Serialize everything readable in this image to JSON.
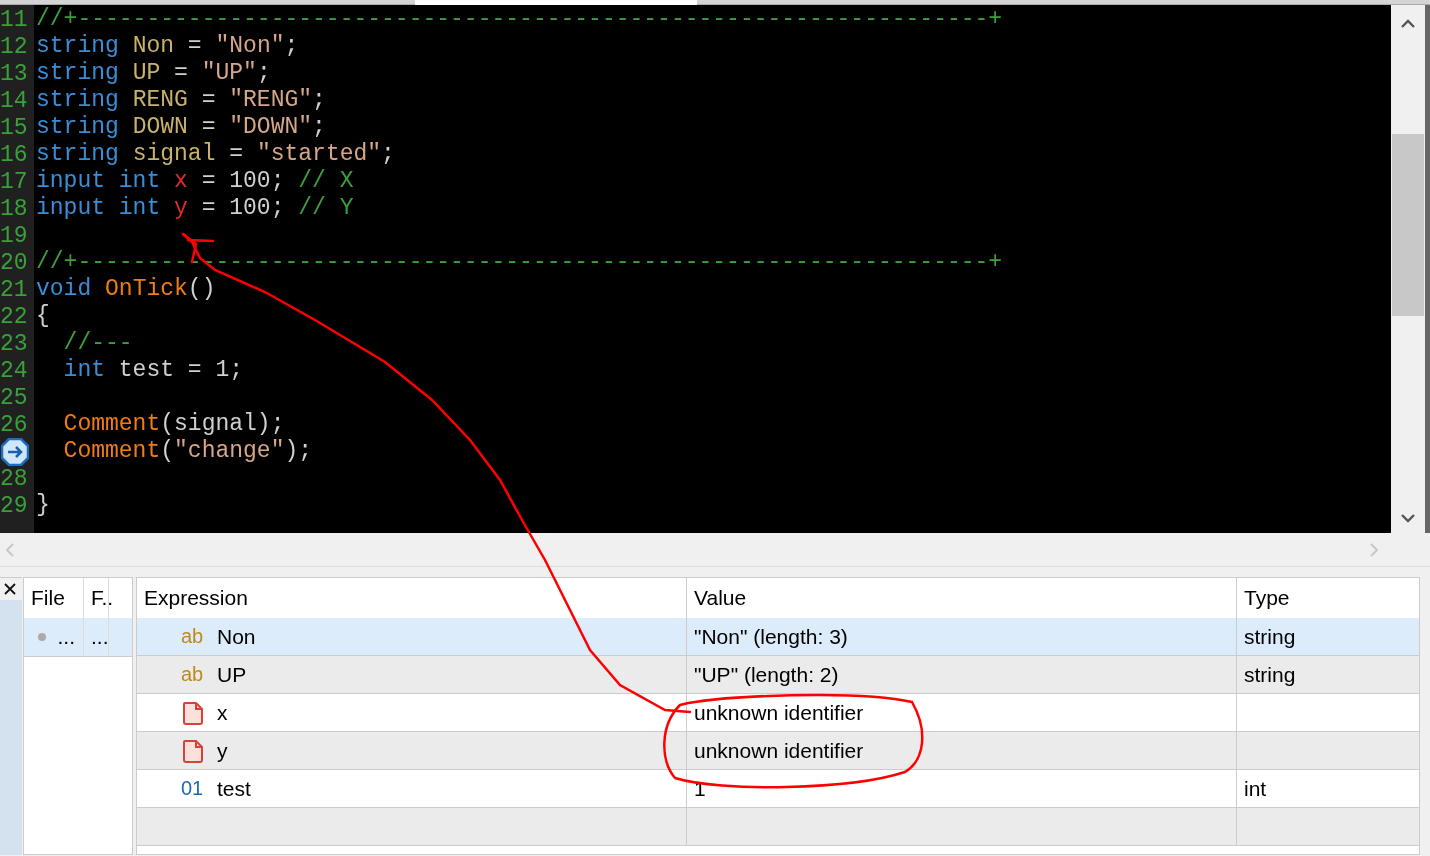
{
  "editor": {
    "lines": [
      {
        "number": "11",
        "tokens": [
          {
            "kind": "comment",
            "text": "//+------------------------------------------------------------------+"
          }
        ]
      },
      {
        "number": "12",
        "tokens": [
          {
            "kind": "keyword",
            "text": "string"
          },
          {
            "kind": "ident",
            "text": " Non"
          },
          {
            "kind": "plain",
            "text": " = "
          },
          {
            "kind": "string",
            "text": "\"Non\""
          },
          {
            "kind": "plain",
            "text": ";"
          }
        ]
      },
      {
        "number": "13",
        "tokens": [
          {
            "kind": "keyword",
            "text": "string"
          },
          {
            "kind": "ident",
            "text": " UP"
          },
          {
            "kind": "plain",
            "text": " = "
          },
          {
            "kind": "string",
            "text": "\"UP\""
          },
          {
            "kind": "plain",
            "text": ";"
          }
        ]
      },
      {
        "number": "14",
        "tokens": [
          {
            "kind": "keyword",
            "text": "string"
          },
          {
            "kind": "ident",
            "text": " RENG"
          },
          {
            "kind": "plain",
            "text": " = "
          },
          {
            "kind": "string",
            "text": "\"RENG\""
          },
          {
            "kind": "plain",
            "text": ";"
          }
        ]
      },
      {
        "number": "15",
        "tokens": [
          {
            "kind": "keyword",
            "text": "string"
          },
          {
            "kind": "ident",
            "text": " DOWN"
          },
          {
            "kind": "plain",
            "text": " = "
          },
          {
            "kind": "string",
            "text": "\"DOWN\""
          },
          {
            "kind": "plain",
            "text": ";"
          }
        ]
      },
      {
        "number": "16",
        "tokens": [
          {
            "kind": "keyword",
            "text": "string"
          },
          {
            "kind": "ident",
            "text": " signal"
          },
          {
            "kind": "plain",
            "text": " = "
          },
          {
            "kind": "string",
            "text": "\"started\""
          },
          {
            "kind": "plain",
            "text": ";"
          }
        ]
      },
      {
        "number": "17",
        "tokens": [
          {
            "kind": "keyword",
            "text": "input int"
          },
          {
            "kind": "input",
            "text": " x"
          },
          {
            "kind": "plain",
            "text": " = 100; "
          },
          {
            "kind": "comment",
            "text": "// X"
          }
        ]
      },
      {
        "number": "18",
        "tokens": [
          {
            "kind": "keyword",
            "text": "input int"
          },
          {
            "kind": "input",
            "text": " y"
          },
          {
            "kind": "plain",
            "text": " = 100; "
          },
          {
            "kind": "comment",
            "text": "// Y"
          }
        ]
      },
      {
        "number": "19"
      },
      {
        "number": "20",
        "tokens": [
          {
            "kind": "comment",
            "text": "//+------------------------------------------------------------------+"
          }
        ]
      },
      {
        "number": "21",
        "tokens": [
          {
            "kind": "keyword",
            "text": "void"
          },
          {
            "kind": "func",
            "text": " OnTick"
          },
          {
            "kind": "plain",
            "text": "()"
          }
        ]
      },
      {
        "number": "22",
        "tokens": [
          {
            "kind": "plain",
            "text": "{"
          }
        ]
      },
      {
        "number": "23",
        "tokens": [
          {
            "kind": "comment",
            "text": "  //---"
          }
        ]
      },
      {
        "number": "24",
        "tokens": [
          {
            "kind": "keyword",
            "text": "  int"
          },
          {
            "kind": "plain",
            "text": " test = 1;"
          }
        ]
      },
      {
        "number": "25"
      },
      {
        "number": "26",
        "tokens": [
          {
            "kind": "func",
            "text": "  Comment"
          },
          {
            "kind": "plain",
            "text": "(signal);"
          }
        ]
      },
      {
        "breakpoint": true,
        "tokens": [
          {
            "kind": "func",
            "text": "  Comment"
          },
          {
            "kind": "plain",
            "text": "("
          },
          {
            "kind": "string",
            "text": "\"change\""
          },
          {
            "kind": "plain",
            "text": ");"
          }
        ]
      },
      {
        "number": "28"
      },
      {
        "number": "29",
        "tokens": [
          {
            "kind": "plain",
            "text": "}"
          }
        ]
      }
    ]
  },
  "files": {
    "columns": [
      "File",
      "F.."
    ],
    "rows": [
      {
        "selected": true,
        "cells": [
          "...",
          "..."
        ]
      }
    ]
  },
  "watch": {
    "columns": [
      "Expression",
      "Value",
      "Type"
    ],
    "rows": [
      {
        "kind": "string",
        "badge": "ab",
        "expression": "Non",
        "value": "\"Non\" (length: 3)",
        "type": "string",
        "selected": true
      },
      {
        "kind": "string",
        "badge": "ab",
        "expression": "UP",
        "value": "\"UP\" (length: 2)",
        "type": "string",
        "selected": false
      },
      {
        "kind": "error",
        "expression": "x",
        "value": "unknown identifier",
        "selected": false
      },
      {
        "kind": "error",
        "expression": "y",
        "value": "unknown identifier",
        "selected": false
      },
      {
        "kind": "int",
        "badge": "01",
        "expression": "test",
        "value": "1",
        "type": "int",
        "selected": false
      }
    ]
  }
}
